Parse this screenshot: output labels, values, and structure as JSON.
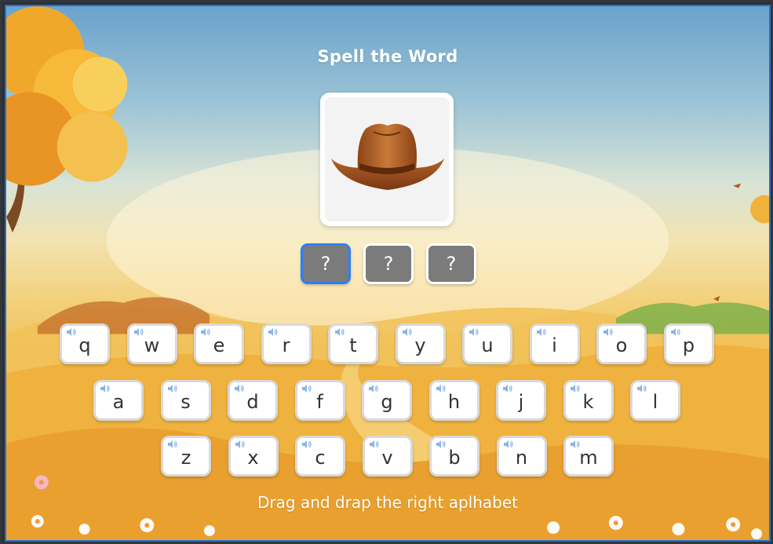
{
  "game": {
    "title": "Spell the Word",
    "picture": {
      "subject": "hat",
      "icon": "cowboy-hat-icon"
    },
    "answer_slots": [
      "?",
      "?",
      "?"
    ],
    "active_slot": 0,
    "keyboard_rows": [
      [
        "q",
        "w",
        "e",
        "r",
        "t",
        "y",
        "u",
        "i",
        "o",
        "p"
      ],
      [
        "a",
        "s",
        "d",
        "f",
        "g",
        "h",
        "j",
        "k",
        "l"
      ],
      [
        "z",
        "x",
        "c",
        "v",
        "b",
        "n",
        "m"
      ]
    ],
    "instruction": "Drag and drap the right aplhabet"
  },
  "colors": {
    "slot_bg": "#7b7b7b",
    "slot_active_border": "#2d7ef7",
    "key_bg": "#ffffff",
    "speaker": "#8ab4e8"
  }
}
